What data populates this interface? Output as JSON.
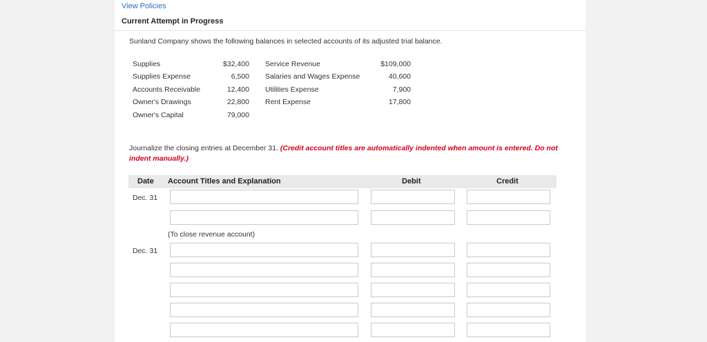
{
  "header": {
    "view_policies": "View Policies",
    "attempt_title": "Current Attempt in Progress"
  },
  "problem": {
    "prompt": "Sunland Company shows the following balances in selected accounts of its adjusted trial balance.",
    "balances_left": [
      {
        "name": "Supplies",
        "amount": "$32,400"
      },
      {
        "name": "Supplies Expense",
        "amount": "6,500"
      },
      {
        "name": "Accounts Receivable",
        "amount": "12,400"
      },
      {
        "name": "Owner's Drawings",
        "amount": "22,800"
      },
      {
        "name": "Owner's Capital",
        "amount": "79,000"
      }
    ],
    "balances_right": [
      {
        "name": "Service Revenue",
        "amount": "$109,000"
      },
      {
        "name": "Salaries and Wages Expense",
        "amount": "40,600"
      },
      {
        "name": "Utilities Expense",
        "amount": "7,900"
      },
      {
        "name": "Rent Expense",
        "amount": "17,800"
      }
    ]
  },
  "journal": {
    "instruction": "Journalize the closing entries at December 31.",
    "note": "(Credit account titles are automatically indented when amount is entered. Do not indent manually.)",
    "columns": {
      "date": "Date",
      "account": "Account Titles and Explanation",
      "debit": "Debit",
      "credit": "Credit"
    },
    "entries": [
      {
        "date": "Dec. 31",
        "explanation": "(To close revenue account)"
      },
      {
        "date": "Dec. 31"
      }
    ]
  }
}
